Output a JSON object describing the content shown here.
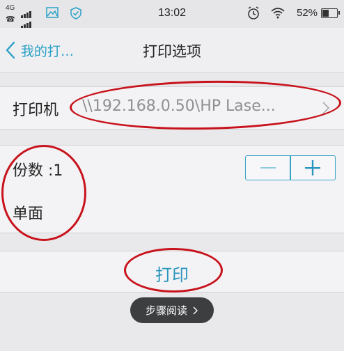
{
  "status_bar": {
    "network": "4G",
    "time": "13:02",
    "battery": "52%",
    "battery_level": 0.52
  },
  "nav": {
    "back_label": "我的打…",
    "title": "打印选项"
  },
  "printer": {
    "label": "打印机",
    "value": "\\\\192.168.0.50\\HP Lase..."
  },
  "copies": {
    "label": "份数 :1",
    "decrement_icon": "minus-icon",
    "increment_icon": "plus-icon"
  },
  "sides": {
    "label": "单面"
  },
  "actions": {
    "print_label": "打印"
  },
  "overlay": {
    "guide_label": "步骤阅读"
  },
  "colors": {
    "accent": "#2aa0c6",
    "annotation": "#c8131c",
    "pill": "#3d3e40"
  }
}
